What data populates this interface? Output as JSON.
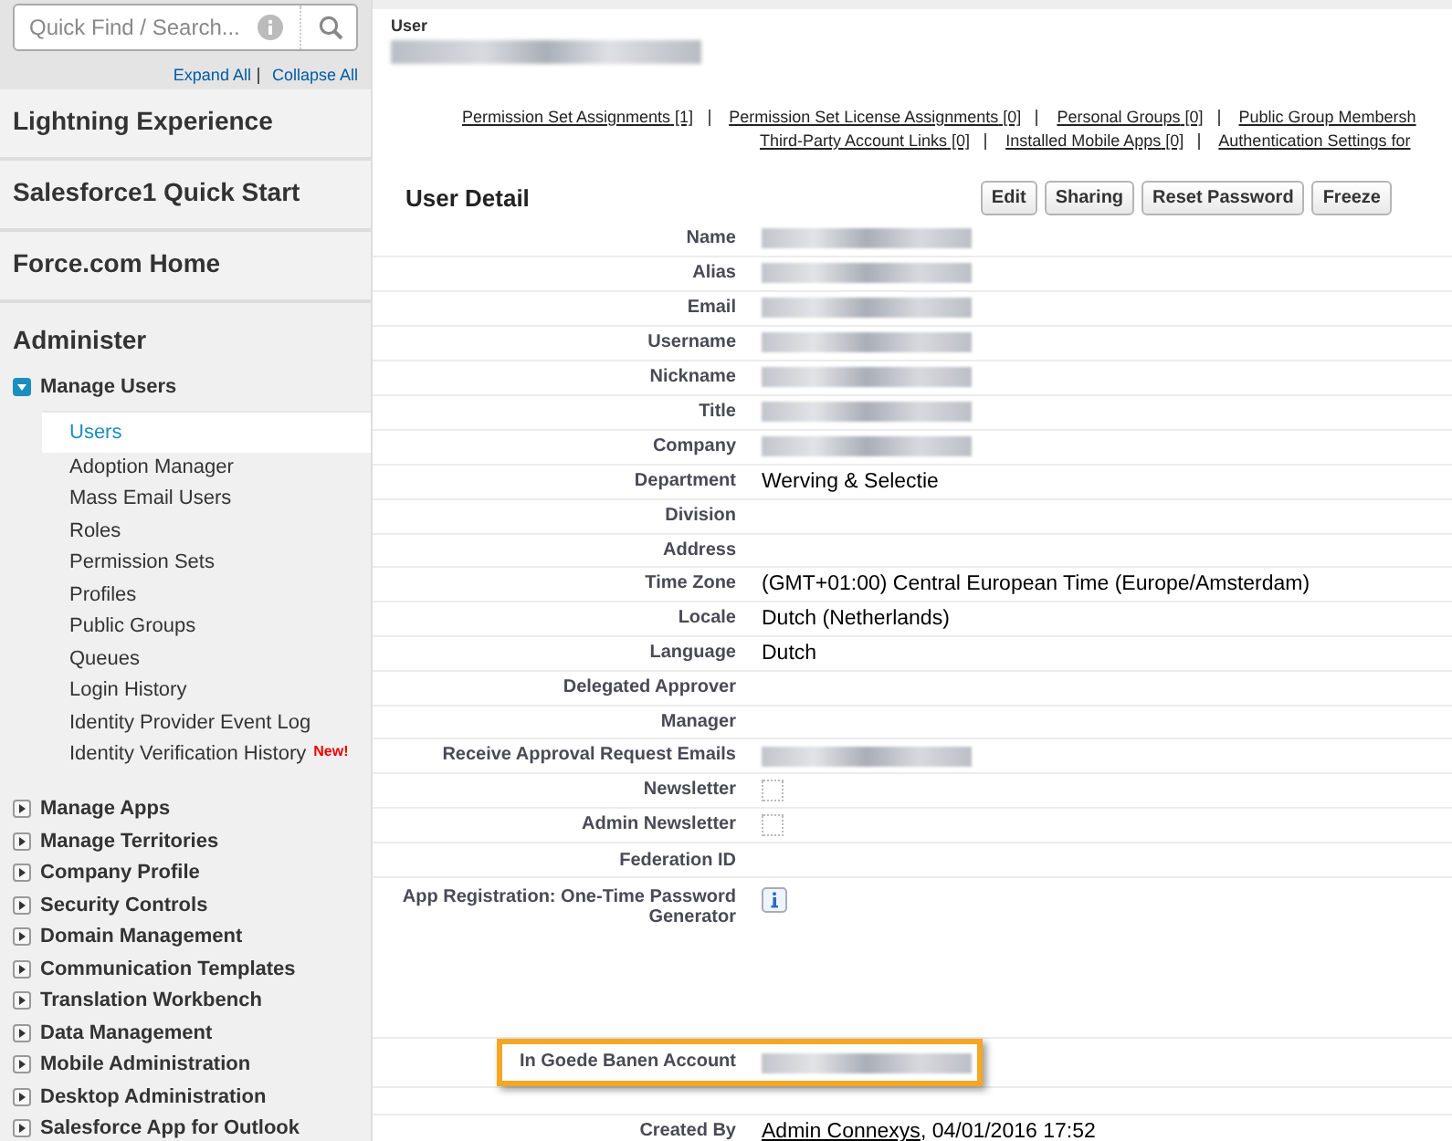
{
  "sidebar": {
    "search": {
      "placeholder": "Quick Find / Search..."
    },
    "links": [
      "Expand All",
      "Collapse All"
    ],
    "sections": [
      {
        "title": "Lightning Experience"
      },
      {
        "title": "Salesforce1 Quick Start"
      },
      {
        "title": "Force.com Home"
      }
    ],
    "group_heading": "Administer",
    "groups": [
      {
        "label": "Manage Users",
        "expanded": true,
        "children": [
          {
            "label": "Users",
            "selected": true
          },
          {
            "label": "Adoption Manager",
            "selected": false
          },
          {
            "label": "Mass Email Users",
            "selected": false
          },
          {
            "label": "Roles",
            "selected": false
          },
          {
            "label": "Permission Sets",
            "selected": false
          },
          {
            "label": "Profiles",
            "selected": false
          },
          {
            "label": "Public Groups",
            "selected": false
          },
          {
            "label": "Queues",
            "selected": false
          },
          {
            "label": "Login History",
            "selected": false
          },
          {
            "label": "Identity Provider Event Log",
            "selected": false
          },
          {
            "label": "Identity Verification History",
            "selected": false,
            "badge": "New!"
          }
        ]
      },
      {
        "label": "Manage Apps",
        "expanded": false
      },
      {
        "label": "Manage Territories",
        "expanded": false
      },
      {
        "label": "Company Profile",
        "expanded": false
      },
      {
        "label": "Security Controls",
        "expanded": false
      },
      {
        "label": "Domain Management",
        "expanded": false
      },
      {
        "label": "Communication Templates",
        "expanded": false
      },
      {
        "label": "Translation Workbench",
        "expanded": false
      },
      {
        "label": "Data Management",
        "expanded": false
      },
      {
        "label": "Mobile Administration",
        "expanded": false
      },
      {
        "label": "Desktop Administration",
        "expanded": false
      },
      {
        "label": "Salesforce App for Outlook",
        "expanded": false
      }
    ]
  },
  "header": {
    "type_label": "User"
  },
  "related_links": [
    [
      {
        "label": "Permission Set Assignments",
        "count": "[1]"
      },
      {
        "label": "Permission Set License Assignments",
        "count": "[0]"
      },
      {
        "label": "Personal Groups",
        "count": "[0]"
      },
      {
        "label": "Public Group Membersh"
      }
    ],
    [
      {
        "label": "Third-Party Account Links",
        "count": "[0]"
      },
      {
        "label": "Installed Mobile Apps",
        "count": "[0]"
      },
      {
        "label": "Authentication Settings for"
      }
    ]
  ],
  "detail": {
    "title": "User Detail",
    "buttons": [
      "Edit",
      "Sharing",
      "Reset Password",
      "Freeze"
    ],
    "fields": [
      {
        "label": "Name",
        "kind": "redacted"
      },
      {
        "label": "Alias",
        "kind": "redacted"
      },
      {
        "label": "Email",
        "kind": "redacted"
      },
      {
        "label": "Username",
        "kind": "redacted"
      },
      {
        "label": "Nickname",
        "kind": "redacted"
      },
      {
        "label": "Title",
        "kind": "redacted"
      },
      {
        "label": "Company",
        "kind": "redacted"
      },
      {
        "label": "Department",
        "kind": "text",
        "value": "Werving & Selectie"
      },
      {
        "label": "Division",
        "kind": "empty"
      },
      {
        "label": "Address",
        "kind": "empty"
      },
      {
        "label": "Time Zone",
        "kind": "text",
        "value": "(GMT+01:00) Central European Time (Europe/Amsterdam)"
      },
      {
        "label": "Locale",
        "kind": "text",
        "value": "Dutch (Netherlands)"
      },
      {
        "label": "Language",
        "kind": "text",
        "value": "Dutch"
      },
      {
        "label": "Delegated Approver",
        "kind": "empty"
      },
      {
        "label": "Manager",
        "kind": "empty"
      },
      {
        "label": "Receive Approval Request Emails",
        "kind": "redacted"
      },
      {
        "label": "Newsletter",
        "kind": "checkbox",
        "checked": false
      },
      {
        "label": "Admin Newsletter",
        "kind": "checkbox",
        "checked": false
      },
      {
        "label": "Federation ID",
        "kind": "empty"
      },
      {
        "label": "App Registration: One-Time Password Generator",
        "kind": "info"
      },
      {
        "label": "In Goede Banen Account",
        "kind": "redacted",
        "highlighted": true
      },
      {
        "label": "Created By",
        "kind": "link",
        "value": "Admin Connexys",
        "suffix": ", 04/01/2016 17:52"
      }
    ]
  }
}
